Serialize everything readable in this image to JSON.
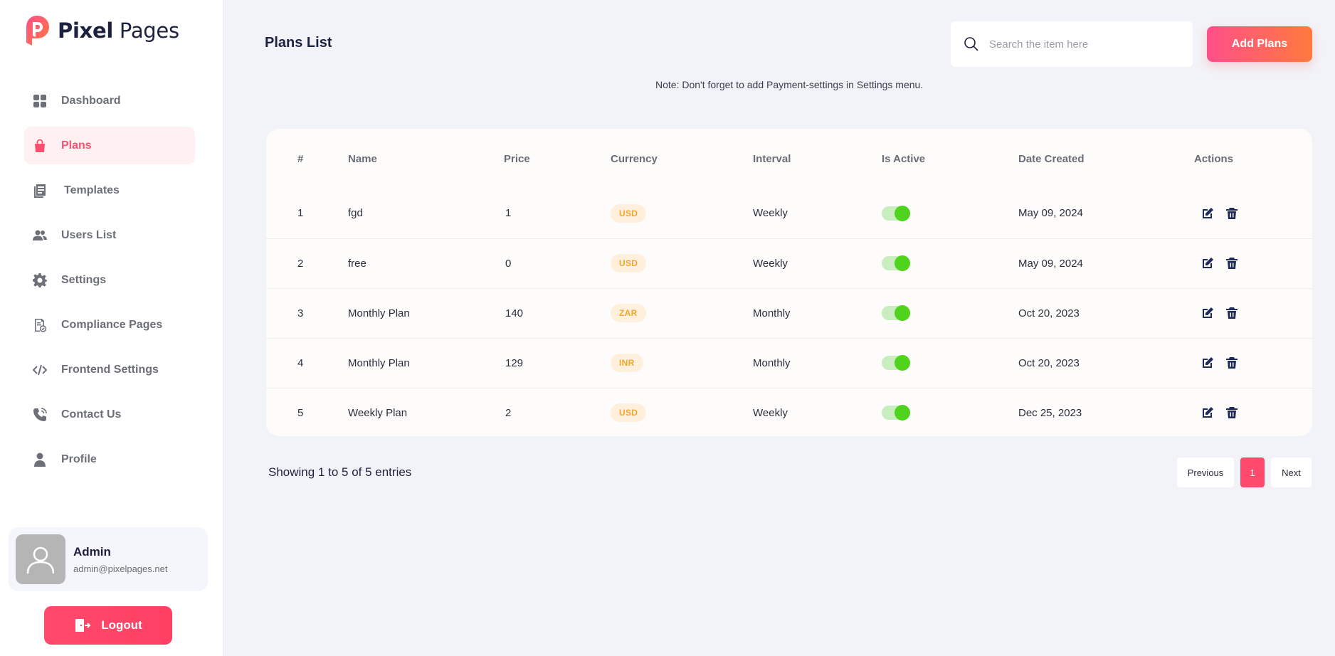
{
  "brand": {
    "name_bold": "Pixel",
    "name_rest": " Pages",
    "accent": "#ff4f6f"
  },
  "sidebar": {
    "items": [
      {
        "label": "Dashboard",
        "icon": "grid-icon"
      },
      {
        "label": "Plans",
        "icon": "shopping-bag-icon",
        "active": true
      },
      {
        "label": "Templates",
        "icon": "documents-icon"
      },
      {
        "label": "Users List",
        "icon": "users-icon"
      },
      {
        "label": "Settings",
        "icon": "gear-icon"
      },
      {
        "label": "Compliance Pages",
        "icon": "compliance-doc-icon"
      },
      {
        "label": "Frontend Settings",
        "icon": "code-icon"
      },
      {
        "label": "Contact Us",
        "icon": "phone-icon"
      },
      {
        "label": "Profile",
        "icon": "person-icon"
      }
    ],
    "admin": {
      "name": "Admin",
      "email": "admin@pixelpages.net"
    },
    "logout_label": "Logout"
  },
  "header": {
    "title": "Plans List",
    "search_placeholder": "Search the item here",
    "add_label": "Add Plans",
    "note": "Note: Don't forget to add Payment-settings in Settings menu."
  },
  "table": {
    "columns": [
      "#",
      "Name",
      "Price",
      "Currency",
      "Interval",
      "Is Active",
      "Date Created",
      "Actions"
    ],
    "rows": [
      {
        "id": "1",
        "name": "fgd",
        "price": "1",
        "currency": "USD",
        "interval": "Weekly",
        "active": true,
        "date": "May 09, 2024"
      },
      {
        "id": "2",
        "name": "free",
        "price": "0",
        "currency": "USD",
        "interval": "Weekly",
        "active": true,
        "date": "May 09, 2024"
      },
      {
        "id": "3",
        "name": "Monthly Plan",
        "price": "140",
        "currency": "ZAR",
        "interval": "Monthly",
        "active": true,
        "date": "Oct 20, 2023"
      },
      {
        "id": "4",
        "name": "Monthly Plan",
        "price": "129",
        "currency": "INR",
        "interval": "Monthly",
        "active": true,
        "date": "Oct 20, 2023"
      },
      {
        "id": "5",
        "name": "Weekly Plan",
        "price": "2",
        "currency": "USD",
        "interval": "Weekly",
        "active": true,
        "date": "Dec 25, 2023"
      }
    ]
  },
  "footer": {
    "showing": "Showing 1 to 5 of 5 entries",
    "prev_label": "Previous",
    "current_page": "1",
    "next_label": "Next"
  }
}
